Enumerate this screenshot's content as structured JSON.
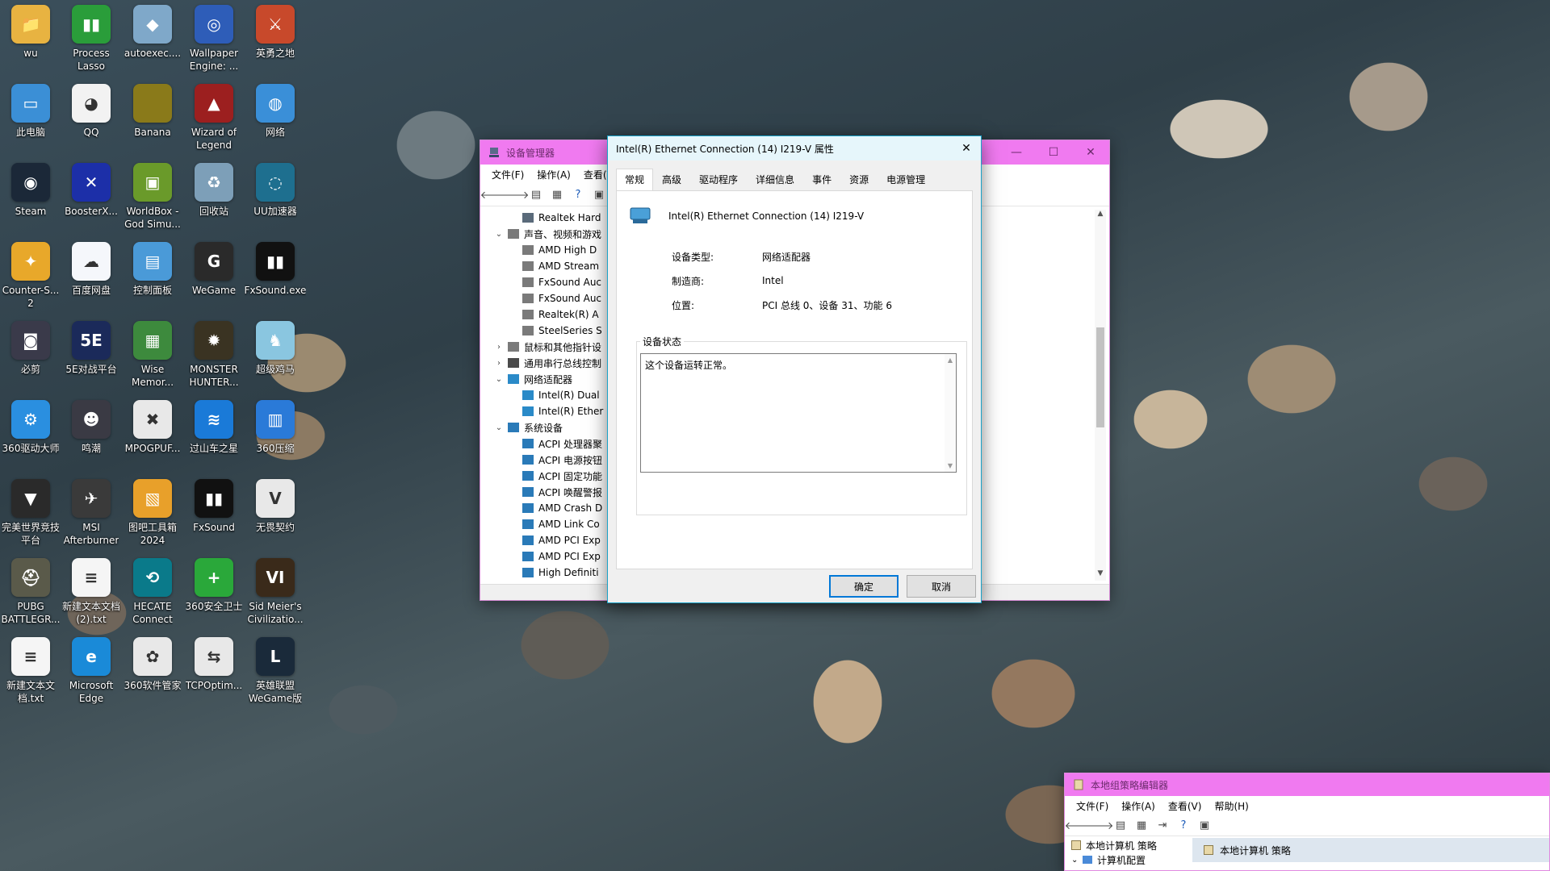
{
  "desktop_icons": [
    {
      "label": "wu",
      "glyph": "📁",
      "color": "#e8b341"
    },
    {
      "label": "Process\nLasso",
      "glyph": "▮▮",
      "color": "#2a9d3a"
    },
    {
      "label": "autoexec....",
      "glyph": "◆",
      "color": "#7fa8c9"
    },
    {
      "label": "Wallpaper\nEngine: ...",
      "glyph": "◎",
      "color": "#2e5db8"
    },
    {
      "label": "英勇之地",
      "glyph": "⚔",
      "color": "#c8492b"
    },
    {
      "label": "此电脑",
      "glyph": "▭",
      "color": "#3b8fd6"
    },
    {
      "label": "QQ",
      "glyph": "◕",
      "color": "#f2f2f2"
    },
    {
      "label": "Banana",
      "glyph": "",
      "color": "#8a7a1a"
    },
    {
      "label": "Wizard of\nLegend",
      "glyph": "▲",
      "color": "#9c1f1f"
    },
    {
      "label": "网络",
      "glyph": "◍",
      "color": "#3a8fd8"
    },
    {
      "label": "Steam",
      "glyph": "◉",
      "color": "#1b2838"
    },
    {
      "label": "BoosterX...",
      "glyph": "✕",
      "color": "#1c2fa8"
    },
    {
      "label": "WorldBox -\nGod Simu...",
      "glyph": "▣",
      "color": "#6a9a2a"
    },
    {
      "label": "回收站",
      "glyph": "♻",
      "color": "#7d9fb8"
    },
    {
      "label": "UU加速器",
      "glyph": "◌",
      "color": "#1e6f8f"
    },
    {
      "label": "Counter-S...\n2",
      "glyph": "✦",
      "color": "#e8a82a"
    },
    {
      "label": "百度网盘",
      "glyph": "☁",
      "color": "#f5f7fb"
    },
    {
      "label": "控制面板",
      "glyph": "▤",
      "color": "#4a9ad8"
    },
    {
      "label": "WeGame",
      "glyph": "G",
      "color": "#2a2a2a"
    },
    {
      "label": "FxSound.exe",
      "glyph": "▮▮",
      "color": "#111111"
    },
    {
      "label": "必剪",
      "glyph": "◙",
      "color": "#3a3a4a"
    },
    {
      "label": "5E对战平台",
      "glyph": "5E",
      "color": "#1b2a5a"
    },
    {
      "label": "Wise\nMemor...",
      "glyph": "▦",
      "color": "#3d8a3d"
    },
    {
      "label": "MONSTER\nHUNTER...",
      "glyph": "✹",
      "color": "#3a3322"
    },
    {
      "label": "超级鸡马",
      "glyph": "♞",
      "color": "#8ac6e0"
    },
    {
      "label": "360驱动大师",
      "glyph": "⚙",
      "color": "#2a8fe0"
    },
    {
      "label": "鸣潮",
      "glyph": "☻",
      "color": "#3a3a44"
    },
    {
      "label": "MPOGPUF...",
      "glyph": "✖",
      "color": "#e8e8e8"
    },
    {
      "label": "过山车之星",
      "glyph": "≋",
      "color": "#1a7ad8"
    },
    {
      "label": "360压缩",
      "glyph": "▥",
      "color": "#2a7ad8"
    },
    {
      "label": "完美世界竞技\n平台",
      "glyph": "▼",
      "color": "#2a2a2a"
    },
    {
      "label": "MSI\nAfterburner",
      "glyph": "✈",
      "color": "#3a3a3a"
    },
    {
      "label": "图吧工具箱\n2024",
      "glyph": "▧",
      "color": "#e8a02a"
    },
    {
      "label": "FxSound",
      "glyph": "▮▮",
      "color": "#111111"
    },
    {
      "label": "无畏契约",
      "glyph": "V",
      "color": "#e8e8e8"
    },
    {
      "label": "PUBG\nBATTLEGR...",
      "glyph": "⛑",
      "color": "#5a5a4a"
    },
    {
      "label": "新建文本文档\n(2).txt",
      "glyph": "≡",
      "color": "#f5f5f5"
    },
    {
      "label": "HECATE\nConnect",
      "glyph": "⟲",
      "color": "#0a7a8a"
    },
    {
      "label": "360安全卫士",
      "glyph": "+",
      "color": "#2aa83a"
    },
    {
      "label": "Sid Meier's\nCivilizatio...",
      "glyph": "VI",
      "color": "#3a2a1a"
    },
    {
      "label": "新建文本文\n档.txt",
      "glyph": "≡",
      "color": "#f5f5f5"
    },
    {
      "label": "Microsoft\nEdge",
      "glyph": "e",
      "color": "#1a8ad8"
    },
    {
      "label": "360软件管家",
      "glyph": "✿",
      "color": "#e8e8e8"
    },
    {
      "label": "TCPOptim...",
      "glyph": "⇆",
      "color": "#e8e8e8"
    },
    {
      "label": "英雄联盟\nWeGame版",
      "glyph": "L",
      "color": "#1a2a3a"
    }
  ],
  "device_manager": {
    "title": "设备管理器",
    "menu": [
      "文件(F)",
      "操作(A)",
      "查看(V)"
    ],
    "tree": [
      {
        "label": "Realtek Hard",
        "level": 2,
        "arrow": "",
        "icon": "#5a6a7a"
      },
      {
        "label": "声音、视频和游戏",
        "level": 1,
        "arrow": "⌄",
        "icon": "#7a7a7a"
      },
      {
        "label": "AMD High D",
        "level": 2,
        "arrow": "",
        "icon": "#7a7a7a"
      },
      {
        "label": "AMD Stream",
        "level": 2,
        "arrow": "",
        "icon": "#7a7a7a"
      },
      {
        "label": "FxSound Auc",
        "level": 2,
        "arrow": "",
        "icon": "#7a7a7a"
      },
      {
        "label": "FxSound Auc",
        "level": 2,
        "arrow": "",
        "icon": "#7a7a7a"
      },
      {
        "label": "Realtek(R) A",
        "level": 2,
        "arrow": "",
        "icon": "#7a7a7a"
      },
      {
        "label": "SteelSeries S",
        "level": 2,
        "arrow": "",
        "icon": "#7a7a7a"
      },
      {
        "label": "鼠标和其他指针设",
        "level": 1,
        "arrow": "›",
        "icon": "#7a7a7a"
      },
      {
        "label": "通用串行总线控制",
        "level": 1,
        "arrow": "›",
        "icon": "#4a4a4a"
      },
      {
        "label": "网络适配器",
        "level": 1,
        "arrow": "⌄",
        "icon": "#2a8ac8"
      },
      {
        "label": "Intel(R) Dual",
        "level": 2,
        "arrow": "",
        "icon": "#2a8ac8"
      },
      {
        "label": "Intel(R) Ether",
        "level": 2,
        "arrow": "",
        "icon": "#2a8ac8"
      },
      {
        "label": "系统设备",
        "level": 1,
        "arrow": "⌄",
        "icon": "#2a7ab8"
      },
      {
        "label": "ACPI 处理器聚",
        "level": 2,
        "arrow": "",
        "icon": "#2a7ab8"
      },
      {
        "label": "ACPI 电源按钮",
        "level": 2,
        "arrow": "",
        "icon": "#2a7ab8"
      },
      {
        "label": "ACPI 固定功能",
        "level": 2,
        "arrow": "",
        "icon": "#2a7ab8"
      },
      {
        "label": "ACPI 唤醒警报",
        "level": 2,
        "arrow": "",
        "icon": "#2a7ab8"
      },
      {
        "label": "AMD Crash D",
        "level": 2,
        "arrow": "",
        "icon": "#2a7ab8"
      },
      {
        "label": "AMD Link Co",
        "level": 2,
        "arrow": "",
        "icon": "#2a7ab8"
      },
      {
        "label": "AMD PCI Exp",
        "level": 2,
        "arrow": "",
        "icon": "#2a7ab8"
      },
      {
        "label": "AMD PCI Exp",
        "level": 2,
        "arrow": "",
        "icon": "#2a7ab8"
      },
      {
        "label": "High Definiti",
        "level": 2,
        "arrow": "",
        "icon": "#2a7ab8"
      }
    ],
    "minimize": "—",
    "maximize": "☐",
    "close": "✕"
  },
  "properties_dialog": {
    "title": "Intel(R) Ethernet Connection (14) I219-V 属性",
    "close": "✕",
    "tabs": [
      "常规",
      "高级",
      "驱动程序",
      "详细信息",
      "事件",
      "资源",
      "电源管理"
    ],
    "active_tab": "常规",
    "device_name": "Intel(R) Ethernet Connection (14) I219-V",
    "fields": [
      {
        "key": "设备类型:",
        "value": "网络适配器"
      },
      {
        "key": "制造商:",
        "value": "Intel"
      },
      {
        "key": "位置:",
        "value": "PCI 总线 0、设备 31、功能 6"
      }
    ],
    "status_group_label": "设备状态",
    "status_text": "这个设备运转正常。",
    "ok_label": "确定",
    "cancel_label": "取消"
  },
  "group_policy": {
    "title": "本地组策略编辑器",
    "menu": [
      "文件(F)",
      "操作(A)",
      "查看(V)",
      "帮助(H)"
    ],
    "tree_root": "本地计算机 策略",
    "tree_child": "计算机配置",
    "right_header": "本地计算机 策略"
  },
  "colors": {
    "title_pink": "#f07af0",
    "dialog_title": "#e6f6fb",
    "accent_blue": "#0078d7"
  }
}
